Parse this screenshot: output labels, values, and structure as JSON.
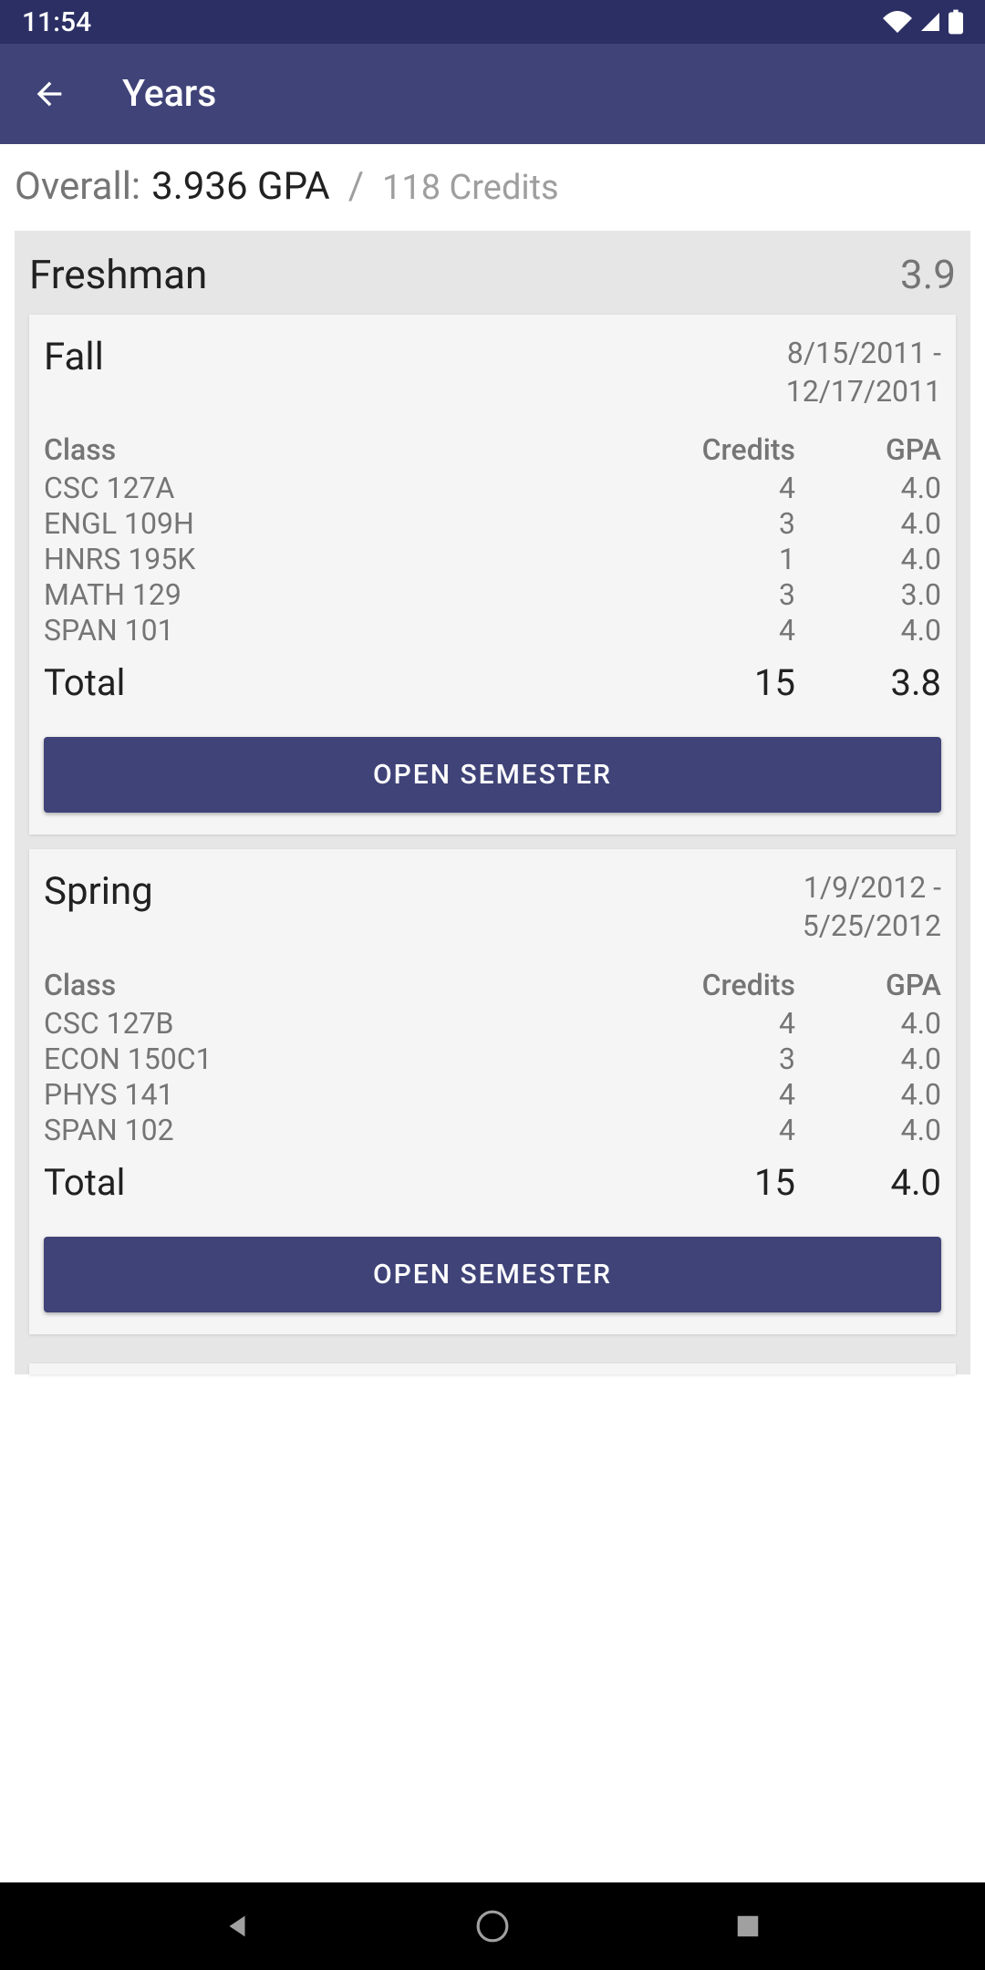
{
  "status_bar": {
    "time": "11:54"
  },
  "app_bar": {
    "title": "Years"
  },
  "overall": {
    "label": "Overall:",
    "gpa": "3.936 GPA",
    "slash": "/",
    "credits": "118 Credits"
  },
  "year": {
    "name": "Freshman",
    "gpa": "3.9"
  },
  "semesters": [
    {
      "name": "Fall",
      "date_line1": "8/15/2011 -",
      "date_line2": "12/17/2011",
      "headers": {
        "class": "Class",
        "credits": "Credits",
        "gpa": "GPA"
      },
      "classes": [
        {
          "name": "CSC 127A",
          "credits": "4",
          "gpa": "4.0"
        },
        {
          "name": "ENGL 109H",
          "credits": "3",
          "gpa": "4.0"
        },
        {
          "name": "HNRS 195K",
          "credits": "1",
          "gpa": "4.0"
        },
        {
          "name": "MATH 129",
          "credits": "3",
          "gpa": "3.0"
        },
        {
          "name": "SPAN 101",
          "credits": "4",
          "gpa": "4.0"
        }
      ],
      "total": {
        "label": "Total",
        "credits": "15",
        "gpa": "3.8"
      },
      "button_label": "OPEN SEMESTER"
    },
    {
      "name": "Spring",
      "date_line1": "1/9/2012 -",
      "date_line2": "5/25/2012",
      "headers": {
        "class": "Class",
        "credits": "Credits",
        "gpa": "GPA"
      },
      "classes": [
        {
          "name": "CSC 127B",
          "credits": "4",
          "gpa": "4.0"
        },
        {
          "name": "ECON 150C1",
          "credits": "3",
          "gpa": "4.0"
        },
        {
          "name": "PHYS 141",
          "credits": "4",
          "gpa": "4.0"
        },
        {
          "name": "SPAN 102",
          "credits": "4",
          "gpa": "4.0"
        }
      ],
      "total": {
        "label": "Total",
        "credits": "15",
        "gpa": "4.0"
      },
      "button_label": "OPEN SEMESTER"
    }
  ]
}
